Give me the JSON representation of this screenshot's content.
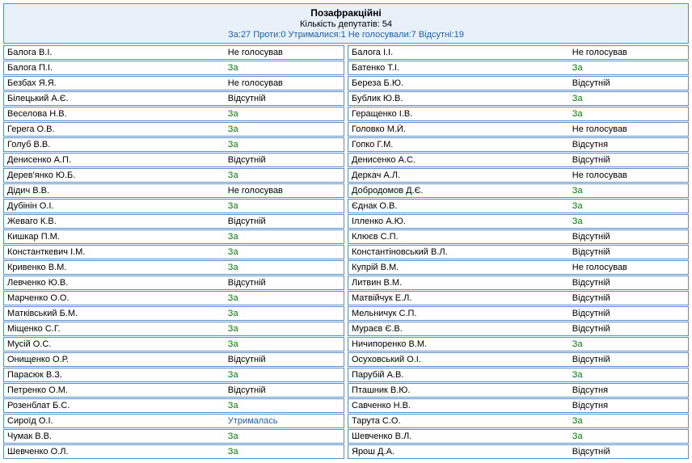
{
  "header": {
    "title": "Позафракційні",
    "count": "Кількість депутатів: 54",
    "summary": "За:27 Проти:0 Утрималися:1 Не голосували:7 Відсутні:19"
  },
  "left": [
    {
      "name": "Балога В.І.",
      "vote": "Не голосував",
      "cls": "vote-no"
    },
    {
      "name": "Балога П.І.",
      "vote": "За",
      "cls": "vote-za"
    },
    {
      "name": "Безбах Я.Я.",
      "vote": "Не голосував",
      "cls": "vote-no"
    },
    {
      "name": "Білецький А.Є.",
      "vote": "Відсутній",
      "cls": "vote-absent"
    },
    {
      "name": "Веселова Н.В.",
      "vote": "За",
      "cls": "vote-za"
    },
    {
      "name": "Герега О.В.",
      "vote": "За",
      "cls": "vote-za"
    },
    {
      "name": "Голуб В.В.",
      "vote": "За",
      "cls": "vote-za"
    },
    {
      "name": "Денисенко А.П.",
      "vote": "Відсутній",
      "cls": "vote-absent"
    },
    {
      "name": "Дерев'янко Ю.Б.",
      "vote": "За",
      "cls": "vote-za"
    },
    {
      "name": "Дідич В.В.",
      "vote": "Не голосував",
      "cls": "vote-no"
    },
    {
      "name": "Дубінін О.І.",
      "vote": "За",
      "cls": "vote-za"
    },
    {
      "name": "Жеваго К.В.",
      "vote": "Відсутній",
      "cls": "vote-absent"
    },
    {
      "name": "Кишкар П.М.",
      "vote": "За",
      "cls": "vote-za"
    },
    {
      "name": "Константкевич І.М.",
      "vote": "За",
      "cls": "vote-za"
    },
    {
      "name": "Кривенко В.М.",
      "vote": "За",
      "cls": "vote-za"
    },
    {
      "name": "Левченко Ю.В.",
      "vote": "Відсутній",
      "cls": "vote-absent"
    },
    {
      "name": "Марченко О.О.",
      "vote": "За",
      "cls": "vote-za"
    },
    {
      "name": "Матківський Б.М.",
      "vote": "За",
      "cls": "vote-za"
    },
    {
      "name": "Міщенко С.Г.",
      "vote": "За",
      "cls": "vote-za"
    },
    {
      "name": "Мусій О.С.",
      "vote": "За",
      "cls": "vote-za"
    },
    {
      "name": "Онищенко О.Р.",
      "vote": "Відсутній",
      "cls": "vote-absent"
    },
    {
      "name": "Парасюк В.З.",
      "vote": "За",
      "cls": "vote-za"
    },
    {
      "name": "Петренко О.М.",
      "vote": "Відсутній",
      "cls": "vote-absent"
    },
    {
      "name": "Розенблат Б.С.",
      "vote": "За",
      "cls": "vote-za"
    },
    {
      "name": "Сироїд О.І.",
      "vote": "Утрималась",
      "cls": "vote-abstain"
    },
    {
      "name": "Чумак В.В.",
      "vote": "За",
      "cls": "vote-za"
    },
    {
      "name": "Шевченко О.Л.",
      "vote": "За",
      "cls": "vote-za"
    }
  ],
  "right": [
    {
      "name": "Балога І.І.",
      "vote": "Не голосував",
      "cls": "vote-no"
    },
    {
      "name": "Батенко Т.І.",
      "vote": "За",
      "cls": "vote-za"
    },
    {
      "name": "Береза Б.Ю.",
      "vote": "Відсутній",
      "cls": "vote-absent"
    },
    {
      "name": "Бублик Ю.В.",
      "vote": "За",
      "cls": "vote-za"
    },
    {
      "name": "Геращенко І.В.",
      "vote": "За",
      "cls": "vote-za"
    },
    {
      "name": "Головко М.Й.",
      "vote": "Не голосував",
      "cls": "vote-no"
    },
    {
      "name": "Гопко Г.М.",
      "vote": "Відсутня",
      "cls": "vote-absent"
    },
    {
      "name": "Денисенко А.С.",
      "vote": "Відсутній",
      "cls": "vote-absent"
    },
    {
      "name": "Деркач А.Л.",
      "vote": "Не голосував",
      "cls": "vote-no"
    },
    {
      "name": "Добродомов Д.Є.",
      "vote": "За",
      "cls": "vote-za"
    },
    {
      "name": "Єднак О.В.",
      "vote": "За",
      "cls": "vote-za"
    },
    {
      "name": "Ілленко А.Ю.",
      "vote": "За",
      "cls": "vote-za"
    },
    {
      "name": "Клюєв С.П.",
      "vote": "Відсутній",
      "cls": "vote-absent"
    },
    {
      "name": "Константіновський В.Л.",
      "vote": "Відсутній",
      "cls": "vote-absent"
    },
    {
      "name": "Купрій В.М.",
      "vote": "Не голосував",
      "cls": "vote-no"
    },
    {
      "name": "Литвин В.М.",
      "vote": "Відсутній",
      "cls": "vote-absent"
    },
    {
      "name": "Матвійчук Е.Л.",
      "vote": "Відсутній",
      "cls": "vote-absent"
    },
    {
      "name": "Мельничук С.П.",
      "vote": "Відсутній",
      "cls": "vote-absent"
    },
    {
      "name": "Мураєв Є.В.",
      "vote": "Відсутній",
      "cls": "vote-absent"
    },
    {
      "name": "Ничипоренко В.М.",
      "vote": "За",
      "cls": "vote-za"
    },
    {
      "name": "Осуховський О.І.",
      "vote": "Відсутній",
      "cls": "vote-absent"
    },
    {
      "name": "Парубій А.В.",
      "vote": "За",
      "cls": "vote-za"
    },
    {
      "name": "Пташник В.Ю.",
      "vote": "Відсутня",
      "cls": "vote-absent"
    },
    {
      "name": "Савченко Н.В.",
      "vote": "Відсутня",
      "cls": "vote-absent"
    },
    {
      "name": "Тарута С.О.",
      "vote": "За",
      "cls": "vote-za"
    },
    {
      "name": "Шевченко В.Л.",
      "vote": "За",
      "cls": "vote-za"
    },
    {
      "name": "Ярош Д.А.",
      "vote": "Відсутній",
      "cls": "vote-absent"
    }
  ]
}
